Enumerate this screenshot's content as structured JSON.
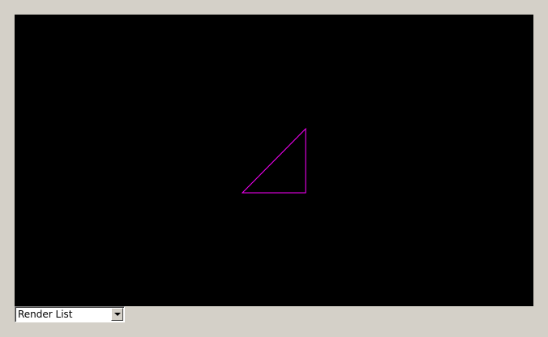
{
  "scene": {
    "background_color": "#000000",
    "triangle": {
      "stroke_color": "#ff00ff"
    }
  },
  "render_mode_select": {
    "selected": "Render List"
  }
}
